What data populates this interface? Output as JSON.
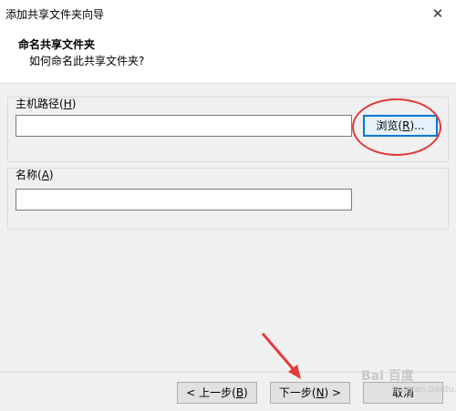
{
  "window": {
    "title": "添加共享文件夹向导",
    "close_glyph": "✕"
  },
  "header": {
    "title": "命名共享文件夹",
    "subtitle": "如何命名此共享文件夹?"
  },
  "host_path": {
    "label_prefix": "主机路径(",
    "label_mnemonic": "H",
    "label_suffix": ")",
    "value": "",
    "browse_button": {
      "prefix": "浏览(",
      "mnemonic": "R",
      "suffix": ")..."
    }
  },
  "name": {
    "label_prefix": "名称(",
    "label_mnemonic": "A",
    "label_suffix": ")",
    "value": ""
  },
  "footer": {
    "back_button": {
      "prefix": "< 上一步(",
      "mnemonic": "B",
      "suffix": ")"
    },
    "next_button": {
      "prefix": "下一步(",
      "mnemonic": "N",
      "suffix": ") >"
    },
    "cancel_button": {
      "label": "取消"
    }
  },
  "watermark": {
    "main": "Bai 百度",
    "sub": "jingyan.baidu.com"
  },
  "colors": {
    "annotation_red": "#e23a3a",
    "focus_blue": "#0078d7"
  }
}
